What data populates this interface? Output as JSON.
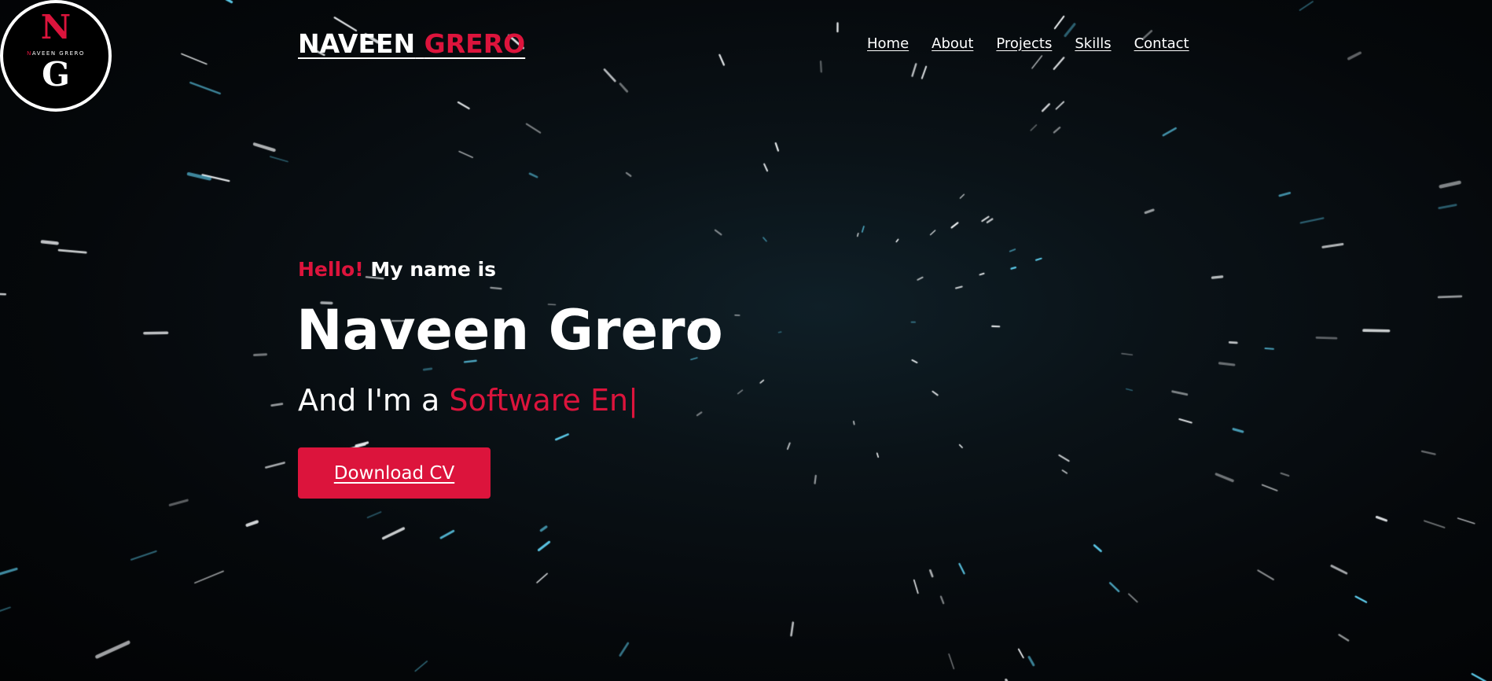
{
  "logo": {
    "top_letter": "N",
    "bottom_letter": "G",
    "subtitle_first": "N",
    "subtitle_rest": "AVEEN GRERO"
  },
  "brand": {
    "first": "NAVEEN",
    "second": "GRERO"
  },
  "nav": {
    "items": [
      "Home",
      "About",
      "Projects",
      "Skills",
      "Contact"
    ]
  },
  "hero": {
    "hello": "Hello!",
    "intro": "My name is",
    "name": "Naveen Grero",
    "role_prefix": "And I'm a",
    "role_typed": "Software En",
    "cursor": "|",
    "cv_button": "Download CV"
  },
  "colors": {
    "accent": "#dc143c",
    "background": "#050709",
    "text": "#ffffff",
    "star_white": "#f2f5f7",
    "star_blue": "#5fd0f0"
  },
  "background_effect": "starfield-warp"
}
